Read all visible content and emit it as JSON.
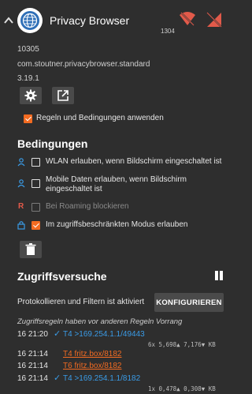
{
  "header": {
    "title": "Privacy Browser",
    "uid": "1304",
    "icons": [
      "chevron-up-icon",
      "app-globe-icon",
      "wifi-off-icon",
      "signal-off-icon"
    ]
  },
  "app_info": {
    "uid_number": "10305",
    "package": "com.stoutner.privacybrowser.standard",
    "version": "3.19.1"
  },
  "actions": {
    "settings_icon": "gear-icon",
    "open_icon": "external-link-icon"
  },
  "apply_rules": {
    "label": "Regeln und Bedingungen anwenden",
    "checked": true
  },
  "conditions": {
    "heading": "Bedingungen",
    "items": [
      {
        "label": "WLAN erlauben, wenn Bildschirm eingeschaltet ist",
        "checked": false
      },
      {
        "label_line1": "Mobile Daten erlauben, wenn Bildschirm",
        "label_line2": "eingeschaltet ist",
        "checked": false
      },
      {
        "prefix": "R",
        "label": "Bei Roaming blockieren",
        "checked": false,
        "disabled": true
      },
      {
        "label": "Im zugriffsbeschränkten Modus erlauben",
        "checked": true
      }
    ]
  },
  "access": {
    "heading": "Zugriffsversuche",
    "logging_text": "Protokollieren und Filtern ist aktiviert",
    "configure_label": "KONFIGURIEREN",
    "note": "Zugriffsregeln haben vor anderen Regeln Vorrang",
    "entries": [
      {
        "time": "16 21:20",
        "dest": "T4 >169.254.1.1/49443",
        "allowed": true,
        "stats": "6x   5,698▲    7,176▼ KB"
      },
      {
        "time": "16 21:14",
        "dest": "T4 fritz.box/8182",
        "allowed": false
      },
      {
        "time": "16 21:14",
        "dest": "T6 fritz.box/8182",
        "allowed": false
      },
      {
        "time": "16 21:14",
        "dest": "T4 >169.254.1.1/8182",
        "allowed": true,
        "stats": "1x   0,478▲    0,308▼ KB"
      }
    ]
  },
  "colors": {
    "background": "#2e2e2e",
    "accent": "#f36b21",
    "link": "#3a9be6",
    "button": "#4a4a4a"
  }
}
